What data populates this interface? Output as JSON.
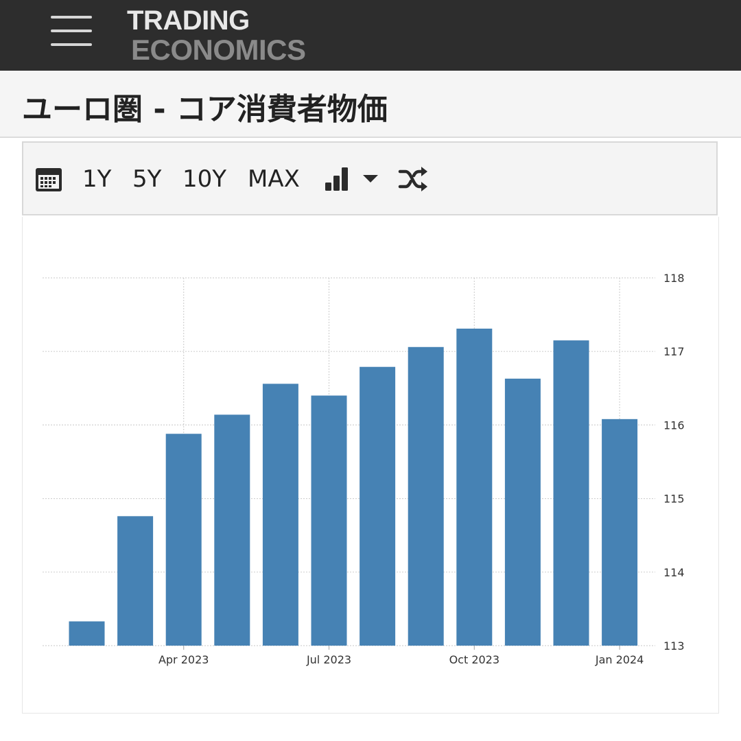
{
  "header": {
    "menu_icon": "hamburger-menu-icon",
    "logo_line1": "TRADING",
    "logo_line2": "ECONOMICS"
  },
  "page": {
    "title": "ユーロ圏 - コア消費者物価"
  },
  "toolbar": {
    "calendar_icon": "calendar-icon",
    "range_buttons": [
      "1Y",
      "5Y",
      "10Y",
      "MAX"
    ],
    "chart_type_icon": "bar-chart-icon",
    "dropdown_icon": "caret-down-icon",
    "compare_icon": "shuffle-icon"
  },
  "colors": {
    "header_bg": "#2d2d2d",
    "bar": "#4682b4"
  },
  "chart_data": {
    "type": "bar",
    "categories": [
      "Feb 2023",
      "Mar 2023",
      "Apr 2023",
      "May 2023",
      "Jun 2023",
      "Jul 2023",
      "Aug 2023",
      "Sep 2023",
      "Oct 2023",
      "Nov 2023",
      "Dec 2023",
      "Jan 2024"
    ],
    "values": [
      113.33,
      114.76,
      115.88,
      116.14,
      116.56,
      116.4,
      116.79,
      117.06,
      117.31,
      116.63,
      117.15,
      116.08
    ],
    "title": "",
    "xlabel": "",
    "ylabel": "",
    "ylim": [
      113,
      118
    ],
    "yticks": [
      "113",
      "114",
      "115",
      "116",
      "117",
      "118"
    ],
    "xtick_labels": [
      {
        "category": "Apr 2023",
        "label": "Apr 2023"
      },
      {
        "category": "Jul 2023",
        "label": "Jul 2023"
      },
      {
        "category": "Oct 2023",
        "label": "Oct 2023"
      },
      {
        "category": "Jan 2024",
        "label": "Jan 2024"
      }
    ],
    "grid": true,
    "y_axis_side": "right"
  }
}
